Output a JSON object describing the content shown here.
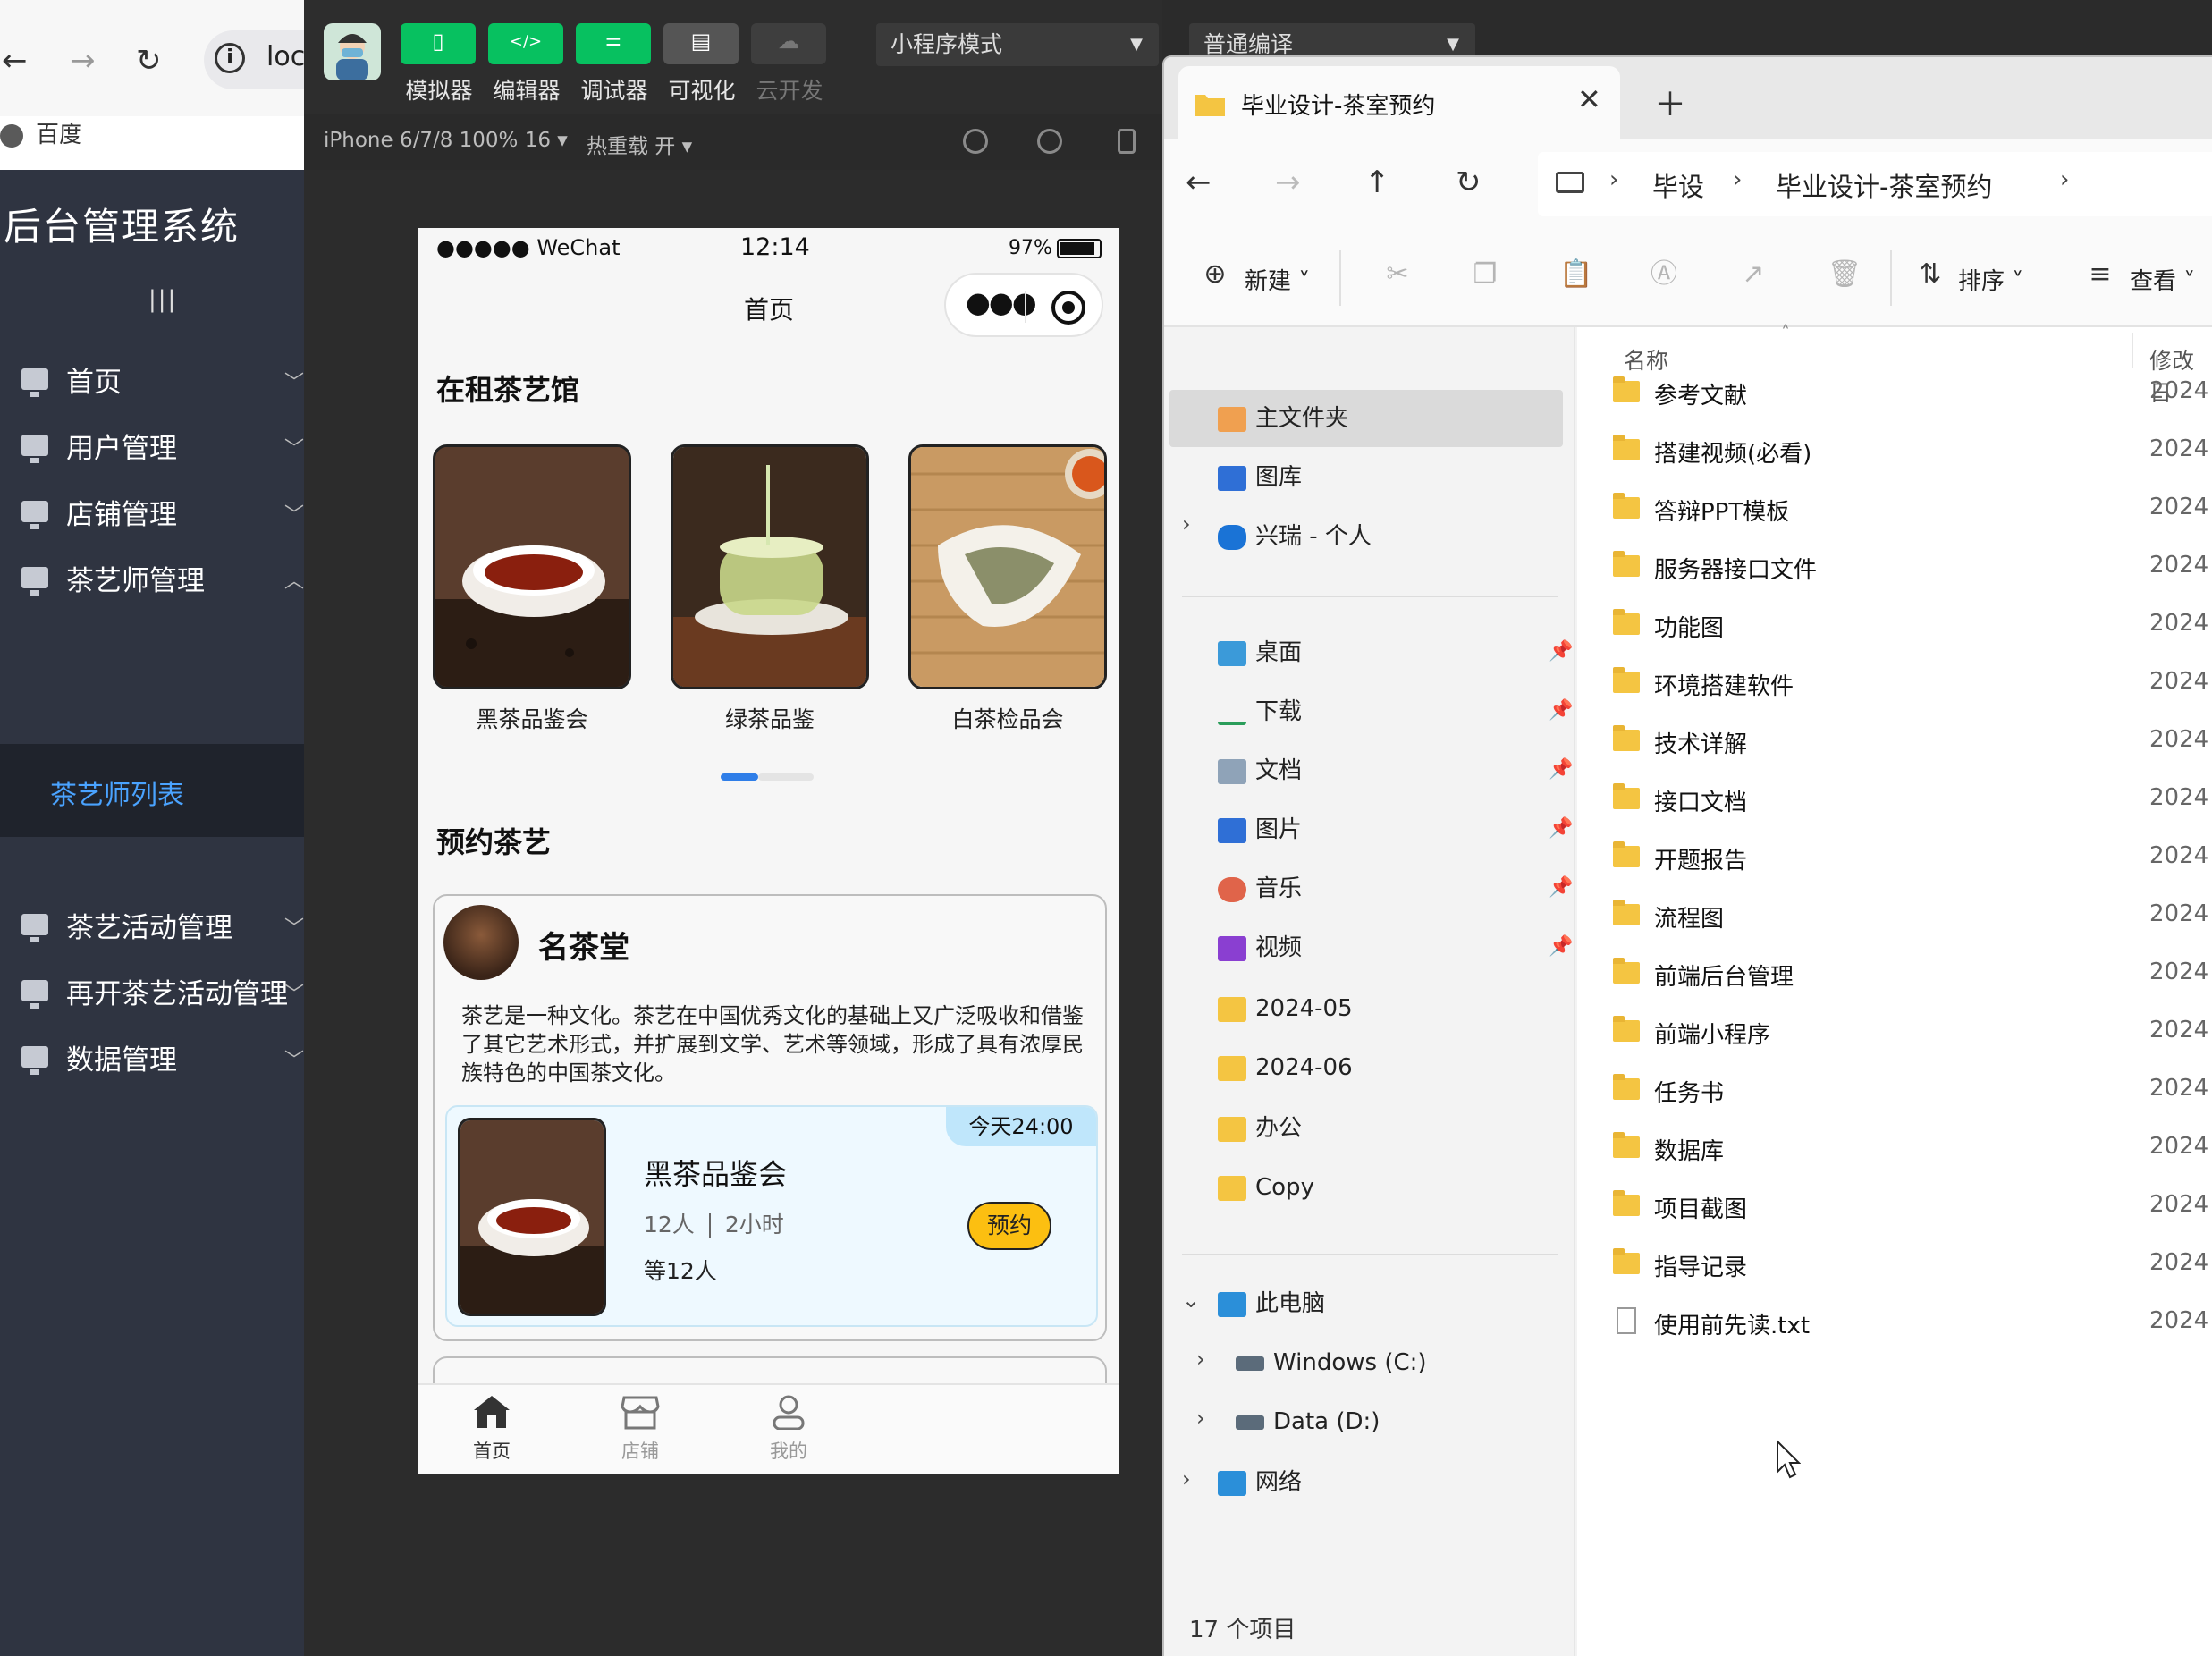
{
  "browser": {
    "back": "←",
    "forward": "→",
    "reload": "↻",
    "address_info": "i",
    "address_text": "loc",
    "bookmark": "百度"
  },
  "admin": {
    "title": "后台管理系统",
    "toggle": "|||",
    "menu": [
      {
        "label": "首页"
      },
      {
        "label": "用户管理"
      },
      {
        "label": "店铺管理"
      },
      {
        "label": "茶艺师管理"
      },
      {
        "label": "茶艺活动管理"
      },
      {
        "label": "再开茶艺活动管理"
      },
      {
        "label": "数据管理"
      }
    ],
    "submenu_active": "茶艺师列表"
  },
  "devtools": {
    "buttons": [
      {
        "label": "模拟器",
        "icon": "phone-icon"
      },
      {
        "label": "编辑器",
        "icon": "code-icon"
      },
      {
        "label": "调试器",
        "icon": "sliders-icon"
      },
      {
        "label": "可视化",
        "icon": "layout-icon"
      },
      {
        "label": "云开发",
        "icon": "cloud-icon"
      }
    ],
    "mode_select": "小程序模式",
    "compile_select": "普通编译",
    "device": "iPhone 6/7/8 100% 16 ▾",
    "hot_reload": "热重载 开 ▾"
  },
  "phone": {
    "carrier": "●●●●● WeChat",
    "time": "12:14",
    "battery": "97%",
    "nav_title": "首页",
    "section_rent": "在租茶艺馆",
    "tea_cards": [
      {
        "label": "黑茶品鉴会"
      },
      {
        "label": "绿茶品鉴"
      },
      {
        "label": "白茶检品会"
      }
    ],
    "section_book": "预约茶艺",
    "shop": {
      "name": "名茶堂",
      "desc": "茶艺是一种文化。茶艺在中国优秀文化的基础上又广泛吸收和借鉴了其它艺术形式，并扩展到文学、艺术等领域，形成了具有浓厚民族特色的中国茶文化。",
      "activity": {
        "badge": "今天24:00",
        "title": "黑茶品鉴会",
        "people": "12人",
        "duration": "2小时",
        "wait": "等12人",
        "book": "预约"
      }
    },
    "tabs": [
      {
        "label": "首页",
        "active": true
      },
      {
        "label": "店铺",
        "active": false
      },
      {
        "label": "我的",
        "active": false
      }
    ]
  },
  "explorer": {
    "tab_title": "毕业设计-茶室预约",
    "crumbs": [
      "毕设",
      "毕业设计-茶室预约"
    ],
    "commands": {
      "new": "新建",
      "sort": "排序",
      "view": "查看"
    },
    "nav_pane": [
      {
        "label": "主文件夹",
        "type": "home"
      },
      {
        "label": "图库",
        "type": "gallery"
      },
      {
        "label": "兴瑞 - 个人",
        "type": "cloud"
      },
      {
        "label": "桌面",
        "type": "desktop"
      },
      {
        "label": "下载",
        "type": "download"
      },
      {
        "label": "文档",
        "type": "docs"
      },
      {
        "label": "图片",
        "type": "pictures"
      },
      {
        "label": "音乐",
        "type": "music"
      },
      {
        "label": "视频",
        "type": "video"
      },
      {
        "label": "2024-05",
        "type": "folder"
      },
      {
        "label": "2024-06",
        "type": "folder"
      },
      {
        "label": "办公",
        "type": "folder"
      },
      {
        "label": "Copy",
        "type": "folder"
      },
      {
        "label": "此电脑",
        "type": "pc"
      },
      {
        "label": "Windows (C:)",
        "type": "drive"
      },
      {
        "label": "Data (D:)",
        "type": "drive"
      },
      {
        "label": "网络",
        "type": "network"
      }
    ],
    "columns": {
      "name": "名称",
      "modified": "修改日"
    },
    "files": [
      {
        "name": "参考文献",
        "date": "2024",
        "type": "folder"
      },
      {
        "name": "搭建视频(必看)",
        "date": "2024",
        "type": "folder"
      },
      {
        "name": "答辩PPT模板",
        "date": "2024",
        "type": "folder"
      },
      {
        "name": "服务器接口文件",
        "date": "2024",
        "type": "folder"
      },
      {
        "name": "功能图",
        "date": "2024",
        "type": "folder"
      },
      {
        "name": "环境搭建软件",
        "date": "2024",
        "type": "folder"
      },
      {
        "name": "技术详解",
        "date": "2024",
        "type": "folder"
      },
      {
        "name": "接口文档",
        "date": "2024",
        "type": "folder"
      },
      {
        "name": "开题报告",
        "date": "2024",
        "type": "folder"
      },
      {
        "name": "流程图",
        "date": "2024",
        "type": "folder"
      },
      {
        "name": "前端后台管理",
        "date": "2024",
        "type": "folder"
      },
      {
        "name": "前端小程序",
        "date": "2024",
        "type": "folder"
      },
      {
        "name": "任务书",
        "date": "2024",
        "type": "folder"
      },
      {
        "name": "数据库",
        "date": "2024",
        "type": "folder"
      },
      {
        "name": "项目截图",
        "date": "2024",
        "type": "folder"
      },
      {
        "name": "指导记录",
        "date": "2024",
        "type": "folder"
      },
      {
        "name": "使用前先读.txt",
        "date": "2024",
        "type": "txt"
      }
    ],
    "status": "17 个项目"
  },
  "colors": {
    "wechat_green": "#07c160",
    "admin_bg": "#2f3441",
    "admin_active": "#4aa3ff",
    "book_yellow": "#fcbf11",
    "folder_yellow": "#f4c542"
  }
}
